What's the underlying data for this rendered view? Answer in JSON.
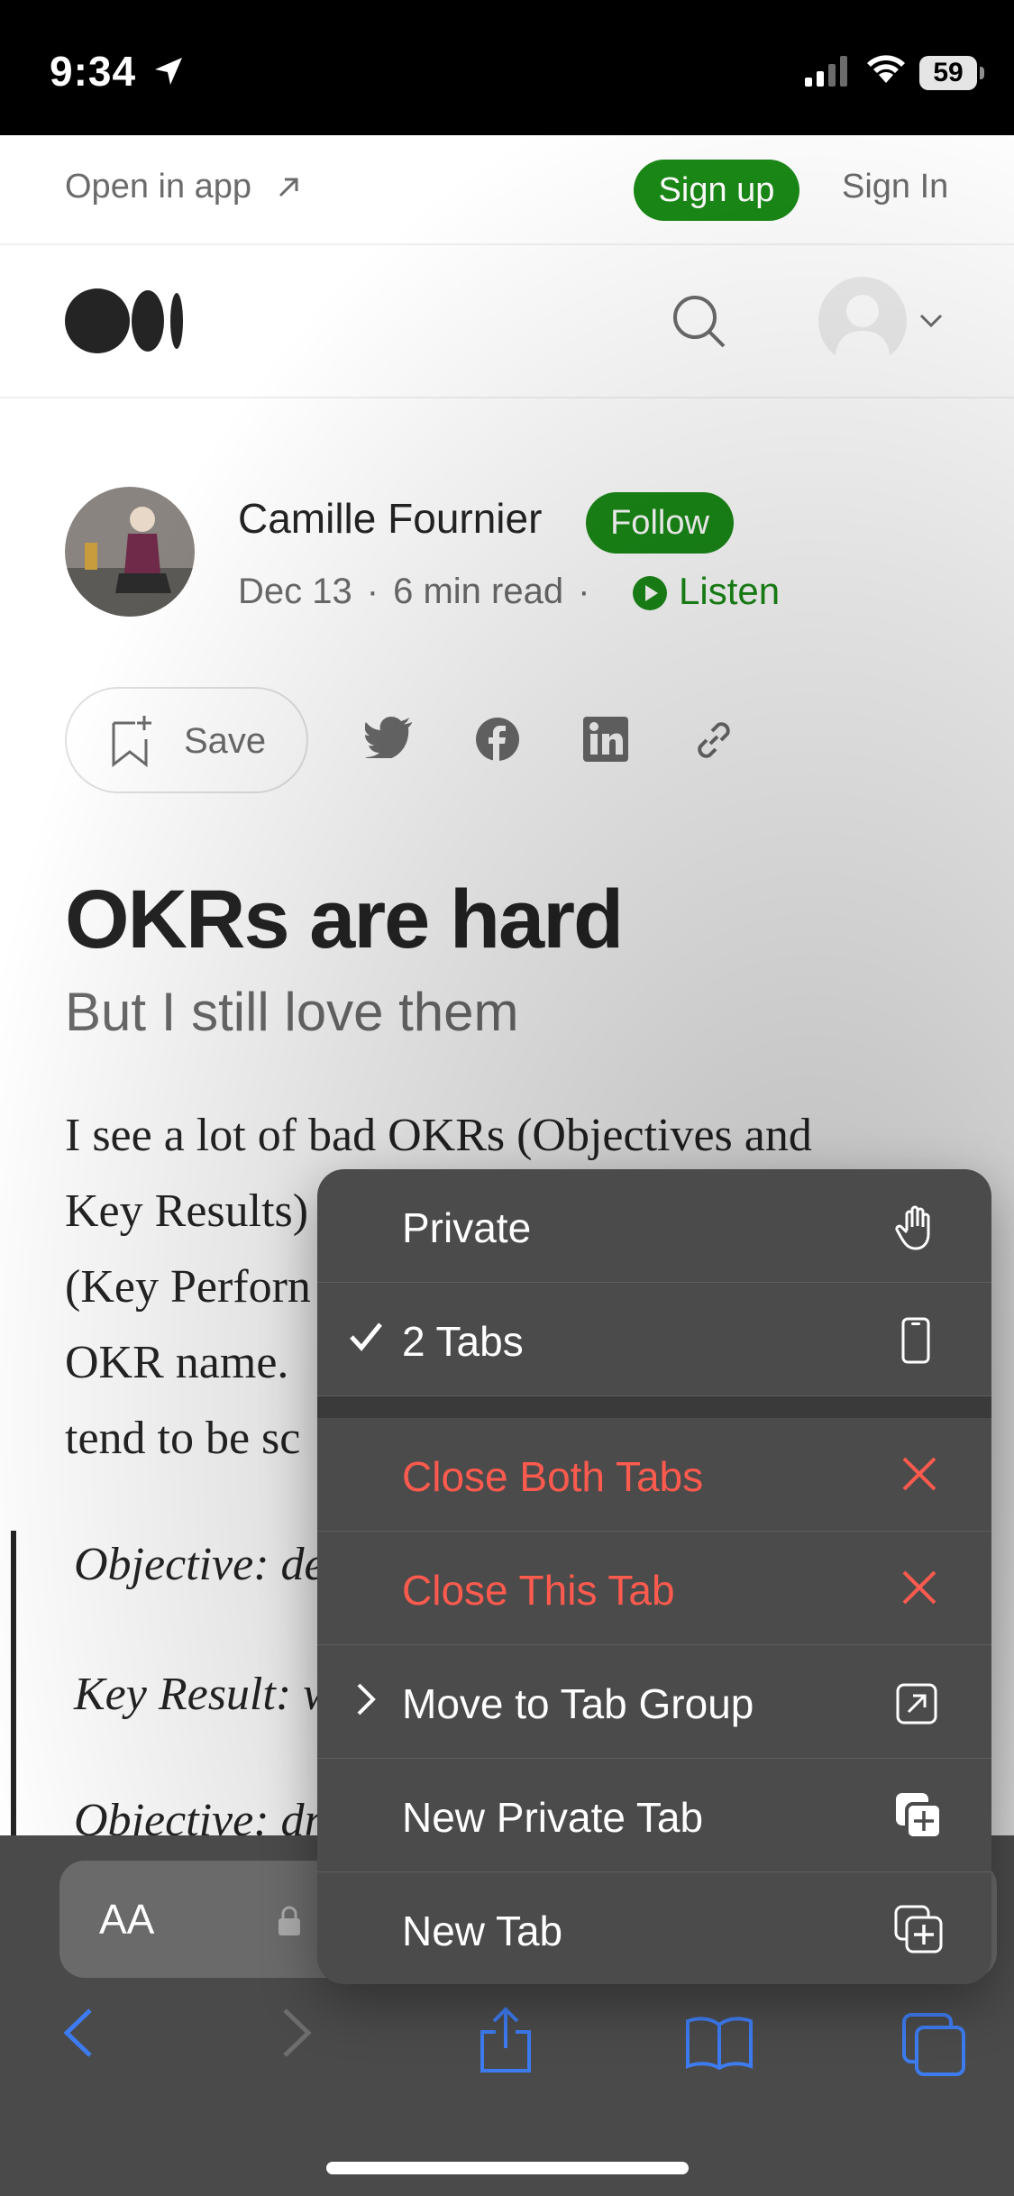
{
  "status_bar": {
    "time": "9:34",
    "battery": "59"
  },
  "app_banner": {
    "open_in_app": "Open in app",
    "sign_up": "Sign up",
    "sign_in": "Sign In"
  },
  "article": {
    "author": "Camille Fournier",
    "follow": "Follow",
    "date": "Dec 13",
    "read_time": "6 min read",
    "listen": "Listen",
    "save": "Save",
    "title": "OKRs are hard",
    "subtitle": "But I still love them",
    "body_lines": [
      "I see a lot of bad OKRs (Objectives and",
      "Key Results)",
      "(Key Perforn",
      "OKR name.",
      "tend to be sc"
    ],
    "quote_lines": [
      "Objective: de",
      "Key Result: w",
      "Objective: dr"
    ]
  },
  "toolbar": {
    "text_size": "AA"
  },
  "menu": {
    "items": [
      {
        "label": "Private",
        "checked": false,
        "destructive": false,
        "icon": "hand-raised-icon"
      },
      {
        "label": "2 Tabs",
        "checked": true,
        "destructive": false,
        "icon": "iphone-icon"
      },
      {
        "label": "Close Both Tabs",
        "checked": false,
        "destructive": true,
        "icon": "close-x-icon"
      },
      {
        "label": "Close This Tab",
        "checked": false,
        "destructive": true,
        "icon": "close-x-icon"
      },
      {
        "label": "Move to Tab Group",
        "checked": false,
        "destructive": false,
        "icon": "arrow-up-right-square-icon"
      },
      {
        "label": "New Private Tab",
        "checked": false,
        "destructive": false,
        "icon": "plus-square-on-square-icon"
      },
      {
        "label": "New Tab",
        "checked": false,
        "destructive": false,
        "icon": "plus-square-on-square-icon"
      }
    ]
  },
  "colors": {
    "medium_green": "#1a8917",
    "destructive_red": "#ff5a4e",
    "menu_bg": "#4b4b4b",
    "toolbar_bg": "#4a4a4a",
    "ios_blue": "#3d7bf0"
  }
}
